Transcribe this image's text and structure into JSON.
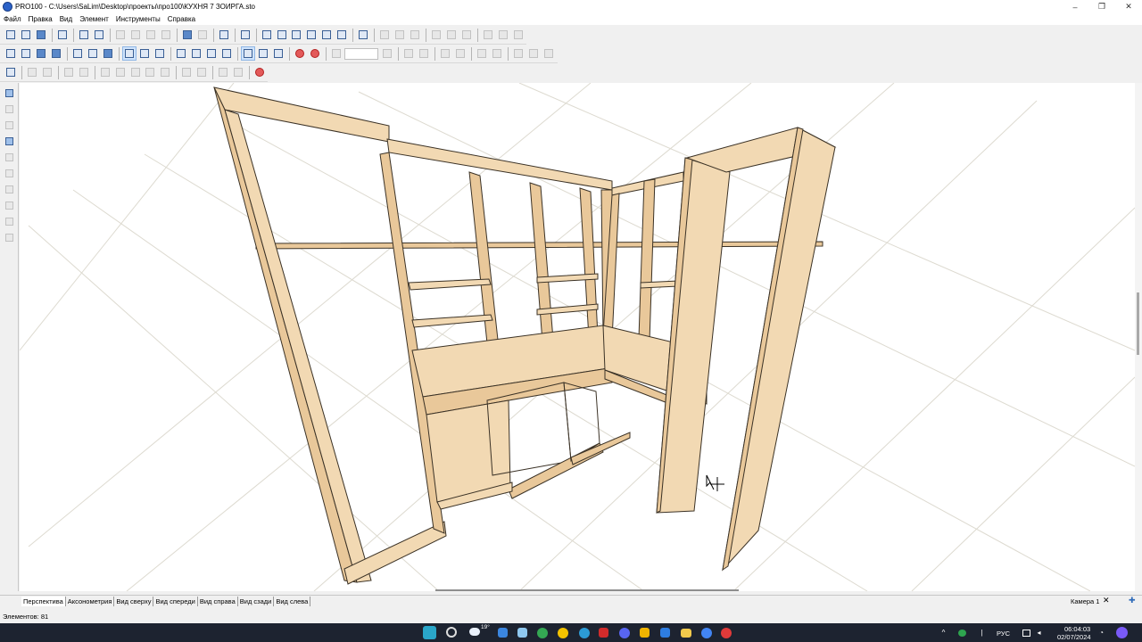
{
  "window": {
    "title": "PRO100 - C:\\Users\\SaLim\\Desktop\\проекты\\про100\\КУХНЯ 7 ЗОИРГА.sto",
    "minimize": "–",
    "maximize": "❐",
    "close": "✕"
  },
  "menu": [
    "Файл",
    "Правка",
    "Вид",
    "Элемент",
    "Инструменты",
    "Справка"
  ],
  "view_tabs": [
    "Перспектива",
    "Аксонометрия",
    "Вид сверху",
    "Вид спереди",
    "Вид справа",
    "Вид сзади",
    "Вид слева"
  ],
  "camera": {
    "label": "Камера 1",
    "close": "✕",
    "add": "✚"
  },
  "status": {
    "elements": "Элементов: 81"
  },
  "taskbar": {
    "weather": "19°",
    "language": "РУС",
    "time": "06:04:03",
    "date": "02/07/2024"
  },
  "colors": {
    "panel_fill": "#f2d9b3",
    "panel_side": "#e9c89a",
    "panel_edge": "#3b3226",
    "grid": "#dddad0",
    "taskbar": "#1d2330",
    "accent": "#2b62c8"
  },
  "icons": {
    "toolbar": [
      "new-file-icon",
      "open-icon",
      "save-icon",
      "print-icon",
      "undo-icon",
      "redo-icon",
      "zoom-icon",
      "view-icon",
      "grid-icon",
      "render-icon",
      "sum-icon"
    ],
    "left": [
      "pointer-icon",
      "select-icon",
      "measure-icon",
      "paint-icon",
      "rotate-icon"
    ]
  }
}
